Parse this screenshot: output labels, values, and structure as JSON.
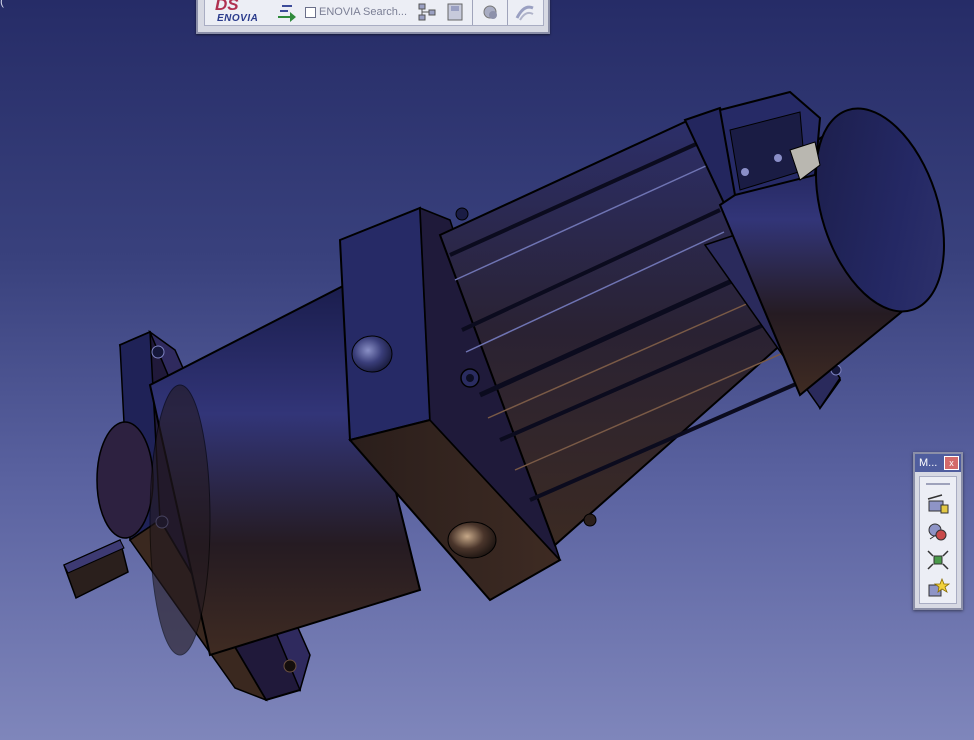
{
  "stray_text": "(",
  "toolbar_top": {
    "logo_ds": "DS",
    "logo_enovia": "ENOVIA",
    "search_label": "ENOVIA Search..."
  },
  "toolbar_right": {
    "title": "M...",
    "close_glyph": "x"
  },
  "icons": [
    "ds-enovia-logo",
    "flow-arrows-icon",
    "checkbox-icon",
    "structure-icon",
    "save-doc-icon",
    "refresh-icon",
    "hyperlink-icon",
    "measure-icon",
    "inertia-icon",
    "fit-all-icon",
    "new-part-icon"
  ],
  "colors": {
    "viewport_top": "#262c67",
    "viewport_bottom": "#7f86bb",
    "part_dark": "#241c1a",
    "part_blue": "#2c2f6b",
    "toolbar_bg": "#d7d9e3",
    "titlebar": "#4f5d9e"
  }
}
